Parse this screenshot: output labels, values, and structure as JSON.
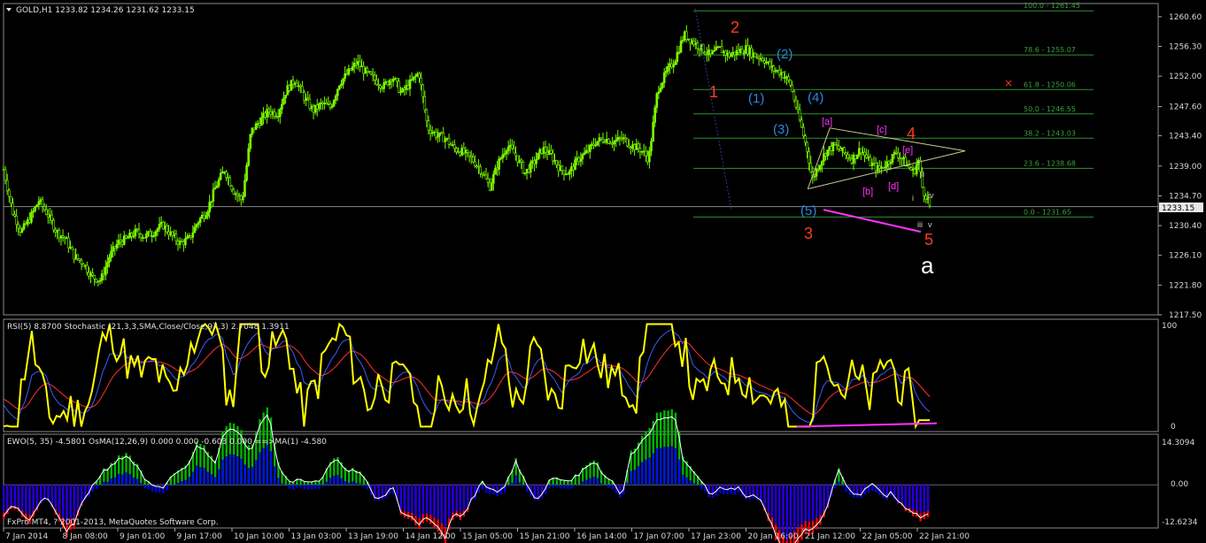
{
  "colors": {
    "background": "#000000",
    "candle_up": "#7CFC00",
    "candle_down": "#7CFC00",
    "grid": "#7a7a7a",
    "fib": "#2f8f2f",
    "rsi": "#ffff00",
    "stoch_main": "#3a5bff",
    "stoch_signal": "#ff3030",
    "ewo_pos": "#00b400",
    "ewo_neg": "#ff0000",
    "osma_pos": "#0000ff",
    "magenta": "#ff33ff",
    "wave_red": "#ff3b1f",
    "wave_blue": "#2a86e0",
    "wave_white": "#ffffff",
    "current_price_line": "#888888"
  },
  "header": {
    "symbol_line": "GOLD,H1  1233.82 1234.26 1231.62 1233.15"
  },
  "main_panel": {
    "price_axis": [
      "1260.60",
      "1256.30",
      "1252.00",
      "1247.60",
      "1243.40",
      "1239.00",
      "1234.70",
      "1230.40",
      "1226.10",
      "1221.80",
      "1217.50"
    ],
    "current_price": "1233.15",
    "fib_levels": [
      {
        "label": "100.0 - 1261.45",
        "price": 1261.45
      },
      {
        "label": "78.6 - 1255.07",
        "price": 1255.07
      },
      {
        "label": "61.8 - 1250.06",
        "price": 1250.06
      },
      {
        "label": "50.0 - 1246.55",
        "price": 1246.55
      },
      {
        "label": "38.2 - 1243.03",
        "price": 1243.03
      },
      {
        "label": "23.6 - 1238.68",
        "price": 1238.68
      },
      {
        "label": "0.0 - 1231.65",
        "price": 1231.65
      }
    ],
    "wave_labels_red": [
      "2",
      "1",
      "3",
      "4",
      "5"
    ],
    "wave_labels_blue": [
      "(2)",
      "(1)",
      "(4)",
      "(3)",
      "(5)"
    ],
    "wave_labels_magenta": [
      "[a]",
      "[c]",
      "[e]",
      "[b]",
      "[d]"
    ],
    "wave_labels_small": [
      "ii",
      "iv",
      "i",
      "iii",
      "v"
    ],
    "wave_label_big": "a",
    "marker": "×"
  },
  "rsi_panel": {
    "title": "RSI(5) 8.8700  Stochastic (21,3,3,SMA,Close/Close,97,3) 2.7048 1.3911",
    "axis": [
      "100",
      "0"
    ]
  },
  "ewo_panel": {
    "title": "EWO(5, 35) -4.5801  OsMA(12,26,9) 0.000 0.000 -0.603 0.000  ==>MA(1) -4.580",
    "axis": [
      "14.3094",
      "0.00",
      "-12.6234"
    ],
    "copyright": "FxPro MT4, ? 2001-2013, MetaQuotes Software Corp."
  },
  "time_axis": [
    "7 Jan 2014",
    "8 Jan 08:00",
    "9 Jan 01:00",
    "9 Jan 17:00",
    "10 Jan 10:00",
    "13 Jan 03:00",
    "13 Jan 19:00",
    "14 Jan 12:00",
    "15 Jan 05:00",
    "15 Jan 21:00",
    "16 Jan 14:00",
    "17 Jan 07:00",
    "17 Jan 23:00",
    "20 Jan 16:00",
    "21 Jan 12:00",
    "22 Jan 05:00",
    "22 Jan 21:00"
  ],
  "chart_data": {
    "type": "candlestick",
    "symbol": "GOLD",
    "timeframe": "H1",
    "ohlc_last": {
      "open": 1233.82,
      "high": 1234.26,
      "low": 1231.62,
      "close": 1233.15
    },
    "ylim": [
      1217.5,
      1262.5
    ],
    "close_path": [
      [
        0,
        1238.5
      ],
      [
        10,
        1232.5
      ],
      [
        20,
        1229.5
      ],
      [
        30,
        1231.5
      ],
      [
        40,
        1234.0
      ],
      [
        50,
        1232.0
      ],
      [
        60,
        1229.5
      ],
      [
        70,
        1228.5
      ],
      [
        80,
        1226.0
      ],
      [
        90,
        1225.0
      ],
      [
        100,
        1223.0
      ],
      [
        110,
        1222.5
      ],
      [
        120,
        1226.0
      ],
      [
        130,
        1228.0
      ],
      [
        140,
        1228.5
      ],
      [
        150,
        1229.5
      ],
      [
        160,
        1228.8
      ],
      [
        170,
        1229.5
      ],
      [
        180,
        1230.5
      ],
      [
        190,
        1229.0
      ],
      [
        200,
        1227.8
      ],
      [
        210,
        1228.5
      ],
      [
        220,
        1231.0
      ],
      [
        230,
        1232.5
      ],
      [
        240,
        1236.0
      ],
      [
        250,
        1238.5
      ],
      [
        260,
        1235.5
      ],
      [
        270,
        1234.0
      ],
      [
        280,
        1244.0
      ],
      [
        290,
        1245.5
      ],
      [
        300,
        1247.0
      ],
      [
        310,
        1246.5
      ],
      [
        320,
        1250.0
      ],
      [
        330,
        1251.5
      ],
      [
        340,
        1249.0
      ],
      [
        350,
        1247.0
      ],
      [
        360,
        1248.0
      ],
      [
        370,
        1247.5
      ],
      [
        380,
        1251.0
      ],
      [
        390,
        1252.5
      ],
      [
        400,
        1254.0
      ],
      [
        410,
        1252.5
      ],
      [
        420,
        1251.5
      ],
      [
        430,
        1250.5
      ],
      [
        440,
        1252.0
      ],
      [
        450,
        1249.5
      ],
      [
        460,
        1251.0
      ],
      [
        470,
        1252.5
      ],
      [
        480,
        1244.5
      ],
      [
        490,
        1243.5
      ],
      [
        500,
        1243.0
      ],
      [
        510,
        1241.5
      ],
      [
        520,
        1241.0
      ],
      [
        530,
        1240.0
      ],
      [
        540,
        1238.5
      ],
      [
        550,
        1236.0
      ],
      [
        560,
        1239.5
      ],
      [
        570,
        1242.0
      ],
      [
        580,
        1240.5
      ],
      [
        590,
        1238.0
      ],
      [
        600,
        1239.5
      ],
      [
        610,
        1241.5
      ],
      [
        620,
        1240.5
      ],
      [
        630,
        1238.5
      ],
      [
        640,
        1238.0
      ],
      [
        650,
        1240.0
      ],
      [
        660,
        1241.0
      ],
      [
        670,
        1242.5
      ],
      [
        680,
        1243.0
      ],
      [
        690,
        1242.5
      ],
      [
        700,
        1243.0
      ],
      [
        710,
        1242.0
      ],
      [
        720,
        1241.5
      ],
      [
        730,
        1240.0
      ],
      [
        740,
        1250.0
      ],
      [
        750,
        1252.5
      ],
      [
        760,
        1254.5
      ],
      [
        770,
        1258.0
      ],
      [
        780,
        1257.0
      ],
      [
        790,
        1256.0
      ],
      [
        800,
        1255.0
      ],
      [
        810,
        1256.0
      ],
      [
        820,
        1255.0
      ],
      [
        830,
        1255.5
      ],
      [
        840,
        1256.0
      ],
      [
        850,
        1255.0
      ],
      [
        860,
        1254.5
      ],
      [
        870,
        1253.0
      ],
      [
        880,
        1252.5
      ],
      [
        890,
        1251.0
      ],
      [
        900,
        1246.0
      ],
      [
        910,
        1241.0
      ],
      [
        915,
        1237.0
      ],
      [
        920,
        1238.5
      ],
      [
        930,
        1241.0
      ],
      [
        940,
        1242.0
      ],
      [
        950,
        1241.0
      ],
      [
        960,
        1240.0
      ],
      [
        970,
        1241.5
      ],
      [
        980,
        1239.5
      ],
      [
        990,
        1238.5
      ],
      [
        1000,
        1239.5
      ],
      [
        1010,
        1241.0
      ],
      [
        1020,
        1239.5
      ],
      [
        1030,
        1238.0
      ],
      [
        1035,
        1240.0
      ],
      [
        1040,
        1235.5
      ],
      [
        1045,
        1234.5
      ],
      [
        1048,
        1233.2
      ]
    ],
    "series": [
      {
        "name": "RSI(5)",
        "last": 8.87
      },
      {
        "name": "Stochastic main",
        "last": 2.7048
      },
      {
        "name": "Stochastic signal",
        "last": 1.3911
      },
      {
        "name": "EWO(5, 35)",
        "last": -4.5801
      },
      {
        "name": "OsMA(12,26,9)",
        "last": -0.603
      }
    ]
  }
}
